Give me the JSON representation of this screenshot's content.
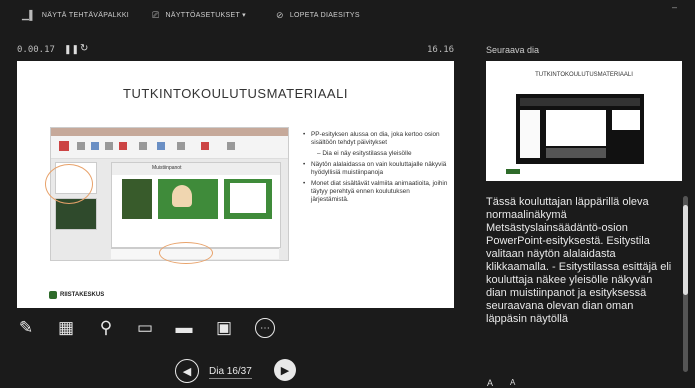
{
  "toolbar": {
    "taskbar_label": "NÄYTÄ TEHTÄVÄPALKKI",
    "display_settings_label": "NÄYTTÖASETUKSET ▾",
    "end_slideshow_label": "LOPETA DIAESITYS",
    "minimize": "–"
  },
  "timer": {
    "elapsed": "0.00.17",
    "clock": "16.16"
  },
  "current_slide": {
    "title": "TUTKINTOKOULUTUSMATERIAALI",
    "bullets": [
      "PP-esityksen alussa on dia, joka kertoo osion sisältöön tehdyt päivitykset",
      "Dia ei näy esitystilassa yleisölle",
      "Näytön alalaidassa on vain kouluttajalle näkyviä hyödyllisiä muistiinpanoja",
      "Monet diat sisältävät valmiita animaatioita, joihin täytyy perehtyä ennen koulutuksen järjestämistä."
    ],
    "inner_panel_title": "Muistiinpanot",
    "logo_text": "RIISTAKESKUS"
  },
  "next_slide": {
    "label": "Seuraava dia",
    "title": "TUTKINTOKOULUTUSMATERIAALI"
  },
  "notes": {
    "text": "Tässä kouluttajan läppärillä oleva normaalinäkymä Metsästyslainsäädäntö-osion PowerPoint-esityksestä. Esitystila valitaan näytön alalaidasta klikkaamalla. - Esitystilassa esittäjä eli kouluttaja näkee yleisölle näkyvän dian muistiinpanot ja esityksessä seuraavana olevan dian oman läppäsin näytöllä"
  },
  "navigation": {
    "counter": "Dia 16/37"
  },
  "icons": {
    "pen": "pen-icon",
    "slides": "all-slides-icon",
    "zoom": "zoom-icon",
    "pointer": "pointer-icon",
    "subtitles": "subtitles-icon",
    "camera": "camera-icon",
    "more": "more-options-icon"
  },
  "colors": {
    "background": "#1b1b1b",
    "accent_orange": "#e8a26a",
    "panel_green": "#3f8b3a"
  }
}
